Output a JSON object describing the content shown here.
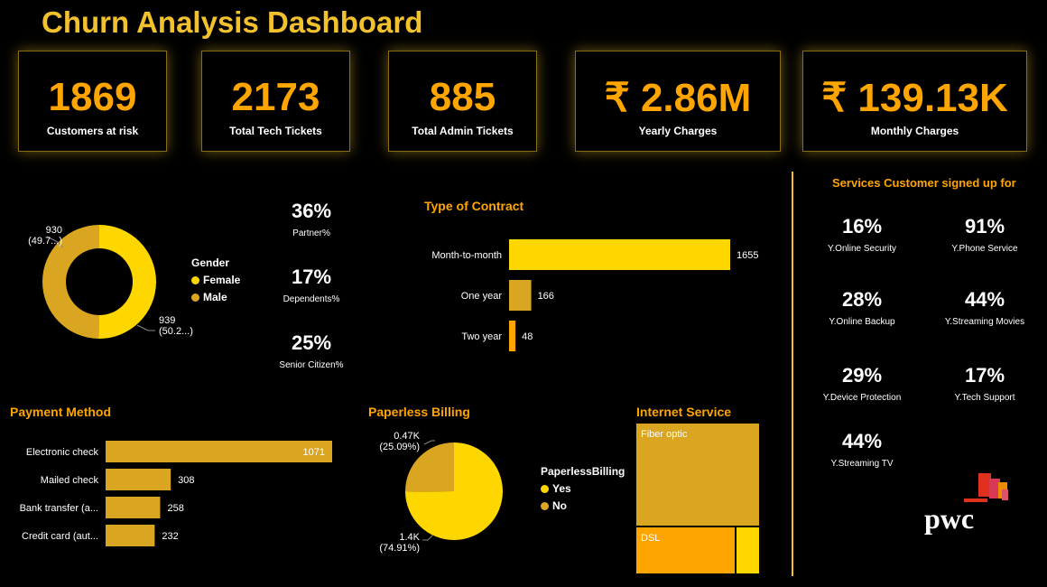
{
  "title": "Churn Analysis Dashboard",
  "kpis": [
    {
      "value": "1869",
      "label": "Customers at risk"
    },
    {
      "value": "2173",
      "label": "Total Tech Tickets"
    },
    {
      "value": "885",
      "label": "Total Admin Tickets"
    },
    {
      "value": "₹ 2.86M",
      "label": "Yearly Charges"
    },
    {
      "value": "₹ 139.13K",
      "label": "Monthly Charges"
    }
  ],
  "gender": {
    "legend_title": "Gender",
    "female_label": "Female",
    "male_label": "Male",
    "female_value_label": "939",
    "female_pct_label": "(50.2...)",
    "male_value_label": "930",
    "male_pct_label": "(49.7...)",
    "female_color": "#FFD700",
    "male_color": "#DAA520"
  },
  "demographics": [
    {
      "value": "36%",
      "label": "Partner%"
    },
    {
      "value": "17%",
      "label": "Dependents%"
    },
    {
      "value": "25%",
      "label": "Senior Citizen%"
    }
  ],
  "contract_title": "Type of Contract",
  "payment_title": "Payment Method",
  "paperless": {
    "title": "Paperless Billing",
    "legend_title": "PaperlessBilling",
    "yes_label": "Yes",
    "no_label": "No",
    "yes_value_label": "1.4K",
    "yes_pct_label": "(74.91%)",
    "no_value_label": "0.47K",
    "no_pct_label": "(25.09%)",
    "yes_color": "#FFD700",
    "no_color": "#DAA520"
  },
  "internet": {
    "title": "Internet Service",
    "fiber_label": "Fiber optic",
    "dsl_label": "DSL"
  },
  "services": {
    "title": "Services Customer signed up for",
    "items": [
      {
        "value": "16%",
        "label": "Y.Online Security"
      },
      {
        "value": "91%",
        "label": "Y.Phone Service"
      },
      {
        "value": "28%",
        "label": "Y.Online Backup"
      },
      {
        "value": "44%",
        "label": "Y.Streaming Movies"
      },
      {
        "value": "29%",
        "label": "Y.Device Protection"
      },
      {
        "value": "17%",
        "label": "Y.Tech Support"
      },
      {
        "value": "44%",
        "label": "Y.Streaming TV"
      }
    ]
  },
  "logo_text": "pwc",
  "chart_data": [
    {
      "type": "pie",
      "legend_title": "Gender",
      "categories": [
        "Female",
        "Male"
      ],
      "values": [
        939,
        930
      ],
      "colors": [
        "#FFD700",
        "#DAA520"
      ]
    },
    {
      "type": "bar",
      "title": "Type of Contract",
      "orientation": "horizontal",
      "categories": [
        "Month-to-month",
        "One year",
        "Two year"
      ],
      "values": [
        1655,
        166,
        48
      ],
      "colors": [
        "#FFD700",
        "#DAA520",
        "#FFA500"
      ]
    },
    {
      "type": "bar",
      "title": "Payment Method",
      "orientation": "horizontal",
      "categories": [
        "Electronic check",
        "Mailed check",
        "Bank transfer (a...",
        "Credit card (aut..."
      ],
      "values": [
        1071,
        308,
        258,
        232
      ],
      "color": "#DAA520"
    },
    {
      "type": "pie",
      "title": "Paperless Billing",
      "legend_title": "PaperlessBilling",
      "categories": [
        "Yes",
        "No"
      ],
      "values": [
        1400,
        470
      ],
      "colors": [
        "#FFD700",
        "#DAA520"
      ]
    }
  ]
}
